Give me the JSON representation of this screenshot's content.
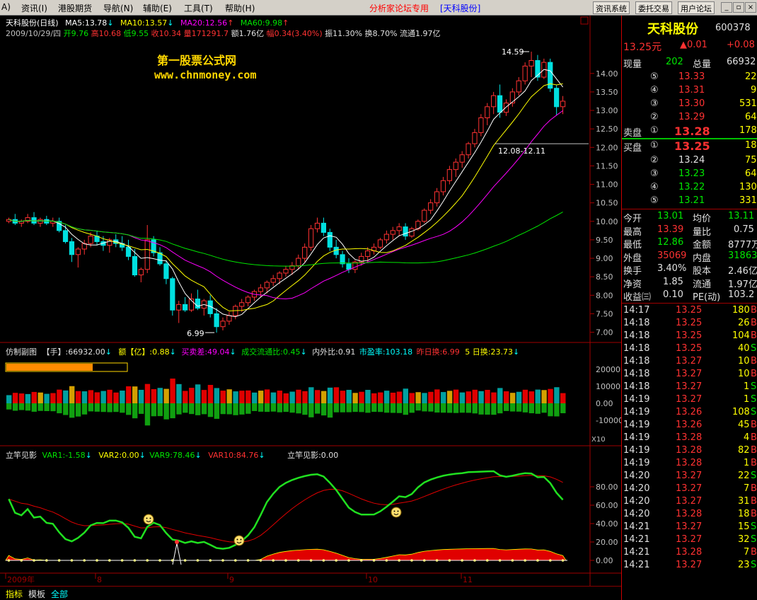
{
  "menu": {
    "items": [
      "资讯(I)",
      "港股期货",
      "导航(N)",
      "辅助(E)",
      "工具(T)",
      "帮助(H)"
    ],
    "prefix": "A)",
    "center_title": "分析家论坛专用",
    "center_stock": "[天科股份]",
    "buttons": [
      "资讯系统",
      "委托交易",
      "用户论坛"
    ]
  },
  "main_chart": {
    "title": "天科股份(日线)",
    "ma5": "MA5:13.78",
    "ma10": "MA10:13.57",
    "ma20": "MA20:12.56",
    "ma60": "MA60:9.98",
    "date": "2009/10/29/四",
    "open": "开9.76",
    "high": "高10.68",
    "low": "低9.55",
    "close": "收10.34",
    "volume": "量171291.7",
    "amount": "额1.76亿",
    "change": "幅0.34(3.40%)",
    "amplitude": "振11.30%",
    "turnover": "换8.70%",
    "float": "流通1.97亿",
    "watermark1": "第一股票公式网",
    "watermark2": "www.chnmoney.com",
    "annot_high": "14.59",
    "annot_low": "6.99",
    "annot_range": "12.08-12.11",
    "price_ticks": [
      "14.00",
      "13.50",
      "13.00",
      "12.50",
      "12.00",
      "11.50",
      "11.00",
      "10.50",
      "10.00",
      "9.50",
      "9.00",
      "8.50",
      "8.00",
      "7.50",
      "7.00"
    ]
  },
  "vol_panel": {
    "name": "仿制副图",
    "hand": "【手】:66932.00",
    "amt": "额【亿】:0.88",
    "buysell": "买卖差:49.04",
    "ratio": "成交流通比:0.45",
    "inout": "内外比:0.91",
    "pe": "市盈率:103.18",
    "yday": "昨日换:6.99",
    "day5": "5 日换:23.73",
    "ticks": [
      "20000",
      "10000",
      "0.00",
      "-10000"
    ],
    "x10": "X10"
  },
  "ind_panel": {
    "name": "立竿见影",
    "var1": "VAR1:-1.58",
    "var2": "VAR2:0.00",
    "var9": "VAR9:78.46",
    "var10": "VAR10:84.76",
    "lg": "立竿见影:0.00",
    "ticks": [
      "80.00",
      "60.00",
      "40.00",
      "20.00",
      "0.00"
    ]
  },
  "date_axis": [
    "2009年",
    "8",
    "9",
    "10",
    "11"
  ],
  "chart_data": {
    "type": "candlestick",
    "title": "天科股份(日线)",
    "period_labels": [
      "2009年",
      "8",
      "9",
      "10",
      "11"
    ],
    "ohlc": [
      [
        10.0,
        10.1,
        9.95,
        10.05
      ],
      [
        10.05,
        10.2,
        9.9,
        9.95
      ],
      [
        9.95,
        10.05,
        9.85,
        10.0
      ],
      [
        10.0,
        10.2,
        9.95,
        10.1
      ],
      [
        10.1,
        10.25,
        9.9,
        9.95
      ],
      [
        9.95,
        10.1,
        9.85,
        10.05
      ],
      [
        10.05,
        10.15,
        9.9,
        9.95
      ],
      [
        9.95,
        10.1,
        9.85,
        10.0
      ],
      [
        10.0,
        10.1,
        9.7,
        9.75
      ],
      [
        9.75,
        9.9,
        9.4,
        9.45
      ],
      [
        9.45,
        9.55,
        8.9,
        9.1
      ],
      [
        9.1,
        9.3,
        8.75,
        9.25
      ],
      [
        9.25,
        9.5,
        9.1,
        9.4
      ],
      [
        9.4,
        9.7,
        9.3,
        9.6
      ],
      [
        9.6,
        9.75,
        9.35,
        9.45
      ],
      [
        9.45,
        9.6,
        9.2,
        9.35
      ],
      [
        9.35,
        9.55,
        9.15,
        9.5
      ],
      [
        9.5,
        9.65,
        9.3,
        9.4
      ],
      [
        9.4,
        9.6,
        9.2,
        9.3
      ],
      [
        9.3,
        9.5,
        8.95,
        9.05
      ],
      [
        9.05,
        9.25,
        8.5,
        8.55
      ],
      [
        8.55,
        8.75,
        8.35,
        8.7
      ],
      [
        8.7,
        9.9,
        8.6,
        9.5
      ],
      [
        9.5,
        9.6,
        9.05,
        9.15
      ],
      [
        9.15,
        9.3,
        8.8,
        8.85
      ],
      [
        8.85,
        8.95,
        8.3,
        8.45
      ],
      [
        8.45,
        8.5,
        7.45,
        7.6
      ],
      [
        7.6,
        7.85,
        7.25,
        7.75
      ],
      [
        7.75,
        7.95,
        7.55,
        7.6
      ],
      [
        7.6,
        8.05,
        7.55,
        7.9
      ],
      [
        7.9,
        8.15,
        7.6,
        7.65
      ],
      [
        7.65,
        7.9,
        7.45,
        7.85
      ],
      [
        7.85,
        8.0,
        7.4,
        7.5
      ],
      [
        7.5,
        7.65,
        6.99,
        7.15
      ],
      [
        7.15,
        7.4,
        7.05,
        7.3
      ],
      [
        7.3,
        7.55,
        7.2,
        7.45
      ],
      [
        7.45,
        7.75,
        7.35,
        7.7
      ],
      [
        7.7,
        7.9,
        7.55,
        7.8
      ],
      [
        7.8,
        8.0,
        7.7,
        7.95
      ],
      [
        7.95,
        8.15,
        7.85,
        8.1
      ],
      [
        8.1,
        8.3,
        7.95,
        8.2
      ],
      [
        8.2,
        8.4,
        8.05,
        8.35
      ],
      [
        8.35,
        8.55,
        8.25,
        8.45
      ],
      [
        8.45,
        8.65,
        8.3,
        8.6
      ],
      [
        8.6,
        8.8,
        8.5,
        8.7
      ],
      [
        8.7,
        8.9,
        8.55,
        8.8
      ],
      [
        8.8,
        9.1,
        8.7,
        9.0
      ],
      [
        9.0,
        9.4,
        8.9,
        9.3
      ],
      [
        9.3,
        9.9,
        9.2,
        9.8
      ],
      [
        9.8,
        10.1,
        9.7,
        9.95
      ],
      [
        9.95,
        10.1,
        9.6,
        9.7
      ],
      [
        9.7,
        9.8,
        9.2,
        9.3
      ],
      [
        9.3,
        9.5,
        9.0,
        9.1
      ],
      [
        9.1,
        9.2,
        8.75,
        8.85
      ],
      [
        8.85,
        9.0,
        8.6,
        8.7
      ],
      [
        8.7,
        8.95,
        8.6,
        8.9
      ],
      [
        8.9,
        9.15,
        8.8,
        9.05
      ],
      [
        9.05,
        9.3,
        8.9,
        9.2
      ],
      [
        9.2,
        9.4,
        9.1,
        9.3
      ],
      [
        9.3,
        9.55,
        9.25,
        9.5
      ],
      [
        9.5,
        9.75,
        9.4,
        9.65
      ],
      [
        9.65,
        9.85,
        9.5,
        9.75
      ],
      [
        9.75,
        9.95,
        9.6,
        9.85
      ],
      [
        9.85,
        9.95,
        9.5,
        9.6
      ],
      [
        9.6,
        9.85,
        9.55,
        9.8
      ],
      [
        9.8,
        10.05,
        9.75,
        10.0
      ],
      [
        10.0,
        10.35,
        9.95,
        10.3
      ],
      [
        10.3,
        10.6,
        10.2,
        10.5
      ],
      [
        10.5,
        10.9,
        10.4,
        10.8
      ],
      [
        10.8,
        11.2,
        10.7,
        11.1
      ],
      [
        11.1,
        11.5,
        11.0,
        11.4
      ],
      [
        11.4,
        11.7,
        11.2,
        11.6
      ],
      [
        11.6,
        11.9,
        11.45,
        11.8
      ],
      [
        11.8,
        12.15,
        11.7,
        12.1
      ],
      [
        12.1,
        12.5,
        12.0,
        12.4
      ],
      [
        12.4,
        12.9,
        12.3,
        12.8
      ],
      [
        12.8,
        13.2,
        12.6,
        13.1
      ],
      [
        13.1,
        13.5,
        12.9,
        13.4
      ],
      [
        13.4,
        13.7,
        12.8,
        12.95
      ],
      [
        12.95,
        13.3,
        12.85,
        13.2
      ],
      [
        13.2,
        13.6,
        13.1,
        13.5
      ],
      [
        13.5,
        13.9,
        13.4,
        13.8
      ],
      [
        13.8,
        14.3,
        13.7,
        14.2
      ],
      [
        14.2,
        14.59,
        13.9,
        14.35
      ],
      [
        14.35,
        14.5,
        13.8,
        13.9
      ],
      [
        13.9,
        14.4,
        13.85,
        14.3
      ],
      [
        14.3,
        14.4,
        13.5,
        13.6
      ],
      [
        13.6,
        13.7,
        12.86,
        13.1
      ],
      [
        13.1,
        13.39,
        12.9,
        13.25
      ]
    ],
    "ma5_last": 13.78,
    "ma10_last": 13.57,
    "ma20_last": 12.56,
    "ma60_last": 9.98,
    "ylim": [
      6.8,
      14.8
    ],
    "volume_axis": [
      -10000,
      0,
      10000,
      20000
    ],
    "indicator_axis": [
      0,
      20,
      40,
      60,
      80
    ]
  },
  "panel": {
    "name": "天科股份",
    "code": "600378",
    "price": "13.25元",
    "arrow": "▲0.01",
    "chg": "+0.08",
    "xianliang_l": "现量",
    "xianliang": "202",
    "zongliang_l": "总量",
    "zongliang": "66932",
    "sells": [
      {
        "n": "⑤",
        "p": "13.33",
        "v": "22"
      },
      {
        "n": "④",
        "p": "13.31",
        "v": "9"
      },
      {
        "n": "③",
        "p": "13.30",
        "v": "531"
      },
      {
        "n": "②",
        "p": "13.29",
        "v": "64"
      }
    ],
    "sell1": {
      "l": "卖盘",
      "n": "①",
      "p": "13.28",
      "v": "178"
    },
    "buy1": {
      "l": "买盘",
      "n": "①",
      "p": "13.25",
      "v": "18"
    },
    "buys": [
      {
        "n": "②",
        "p": "13.24",
        "v": "75"
      },
      {
        "n": "③",
        "p": "13.23",
        "v": "64"
      },
      {
        "n": "④",
        "p": "13.22",
        "v": "130"
      },
      {
        "n": "⑤",
        "p": "13.21",
        "v": "331"
      }
    ],
    "stats": [
      [
        {
          "l": "今开",
          "v": "13.01",
          "c": "grn"
        },
        {
          "l": "均价",
          "v": "13.11",
          "c": "grn"
        }
      ],
      [
        {
          "l": "最高",
          "v": "13.39",
          "c": "red"
        },
        {
          "l": "量比",
          "v": "0.75",
          "c": "wht"
        }
      ],
      [
        {
          "l": "最低",
          "v": "12.86",
          "c": "grn"
        },
        {
          "l": "金额",
          "v": "8777万",
          "c": "wht"
        }
      ],
      [
        {
          "l": "外盘",
          "v": "35069",
          "c": "red"
        },
        {
          "l": "内盘",
          "v": "31863",
          "c": "grn"
        }
      ],
      [
        {
          "l": "换手",
          "v": "3.40%",
          "c": "wht"
        },
        {
          "l": "股本",
          "v": "2.46亿",
          "c": "wht"
        }
      ],
      [
        {
          "l": "净资",
          "v": "1.85",
          "c": "wht"
        },
        {
          "l": "流通",
          "v": "1.97亿",
          "c": "wht"
        }
      ],
      [
        {
          "l": "收益㈢",
          "v": "0.10",
          "c": "wht"
        },
        {
          "l": "PE(动)",
          "v": "103.2",
          "c": "wht"
        }
      ]
    ],
    "ticks": [
      {
        "t": "14:17",
        "p": "13.25",
        "v": "180",
        "s": "B"
      },
      {
        "t": "14:18",
        "p": "13.25",
        "v": "26",
        "s": "B"
      },
      {
        "t": "14:18",
        "p": "13.25",
        "v": "104",
        "s": "B"
      },
      {
        "t": "14:18",
        "p": "13.25",
        "v": "40",
        "s": "S"
      },
      {
        "t": "14:18",
        "p": "13.27",
        "v": "10",
        "s": "B"
      },
      {
        "t": "14:18",
        "p": "13.27",
        "v": "10",
        "s": "B"
      },
      {
        "t": "14:18",
        "p": "13.27",
        "v": "1",
        "s": "S"
      },
      {
        "t": "14:19",
        "p": "13.27",
        "v": "1",
        "s": "S"
      },
      {
        "t": "14:19",
        "p": "13.26",
        "v": "108",
        "s": "S"
      },
      {
        "t": "14:19",
        "p": "13.26",
        "v": "45",
        "s": "B"
      },
      {
        "t": "14:19",
        "p": "13.28",
        "v": "4",
        "s": "B"
      },
      {
        "t": "14:19",
        "p": "13.28",
        "v": "82",
        "s": "B"
      },
      {
        "t": "14:19",
        "p": "13.28",
        "v": "1",
        "s": "B"
      },
      {
        "t": "14:20",
        "p": "13.27",
        "v": "22",
        "s": "S"
      },
      {
        "t": "14:20",
        "p": "13.27",
        "v": "7",
        "s": "B"
      },
      {
        "t": "14:20",
        "p": "13.27",
        "v": "31",
        "s": "B"
      },
      {
        "t": "14:20",
        "p": "13.28",
        "v": "18",
        "s": "B"
      },
      {
        "t": "14:21",
        "p": "13.27",
        "v": "15",
        "s": "S"
      },
      {
        "t": "14:21",
        "p": "13.27",
        "v": "32",
        "s": "S"
      },
      {
        "t": "14:21",
        "p": "13.28",
        "v": "7",
        "s": "B"
      },
      {
        "t": "14:21",
        "p": "13.27",
        "v": "23",
        "s": "S"
      }
    ]
  },
  "bottom": {
    "tab1": "指标",
    "tab2": "模板",
    "tab3": "全部"
  }
}
